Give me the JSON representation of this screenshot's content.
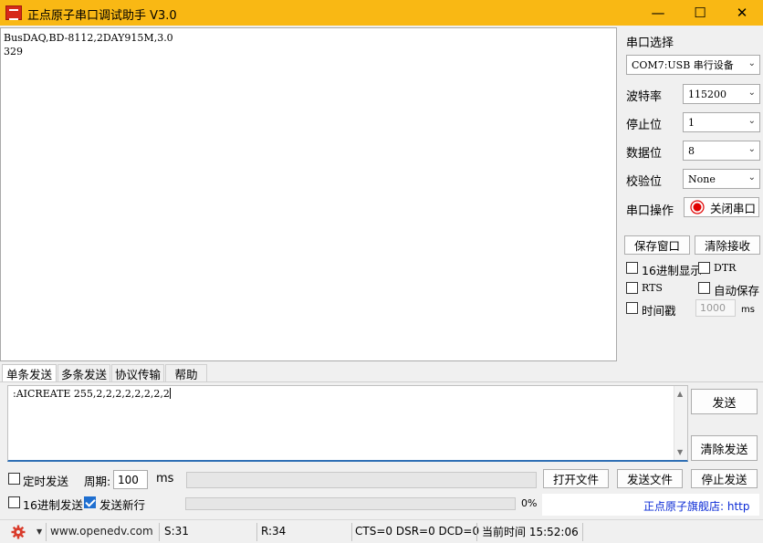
{
  "window": {
    "title": "正点原子串口调试助手 V3.0",
    "minimize": "—",
    "maximize": "☐",
    "close": "✕"
  },
  "receive": {
    "text": "BusDAQ,BD-8112,2DAY915M,3.0\n329"
  },
  "serial": {
    "select_label": "串口选择",
    "port_value": "COM7:USB 串行设备",
    "baud_label": "波特率",
    "baud_value": "115200",
    "stop_label": "停止位",
    "stop_value": "1",
    "data_label": "数据位",
    "data_value": "8",
    "parity_label": "校验位",
    "parity_value": "None",
    "op_label": "串口操作",
    "close_port_button": "关闭串口",
    "status_color": "#e00000"
  },
  "options": {
    "save_window_button": "保存窗口",
    "clear_receive_button": "清除接收",
    "hex_display": "16进制显示",
    "dtr": "DTR",
    "rts": "RTS",
    "auto_save": "自动保存",
    "timestamp": "时间戳",
    "timestamp_value": "1000",
    "timestamp_unit": "ms"
  },
  "tabs": [
    {
      "label": "单条发送",
      "active": true
    },
    {
      "label": "多条发送",
      "active": false
    },
    {
      "label": "协议传输",
      "active": false
    },
    {
      "label": "帮助",
      "active": false
    }
  ],
  "send": {
    "text": ":AICREATE 255,2,2,2,2,2,2,2,2",
    "send_button": "发送",
    "clear_send_button": "清除发送",
    "timed_send": "定时发送",
    "period_label": "周期:",
    "period_value": "100",
    "period_unit": "ms",
    "open_file_button": "打开文件",
    "send_file_button": "发送文件",
    "stop_send_button": "停止发送",
    "hex_send": "16进制发送",
    "send_newline": "发送新行",
    "send_newline_checked": true,
    "progress_percent": "0%",
    "progress_value": 0,
    "store_link": "正点原子旗舰店: http"
  },
  "status": {
    "website": "www.openedv.com",
    "sent": "S:31",
    "received": "R:34",
    "signals": "CTS=0 DSR=0 DCD=0",
    "time": "当前时间 15:52:06",
    "gear_color": "#d93b2b"
  }
}
